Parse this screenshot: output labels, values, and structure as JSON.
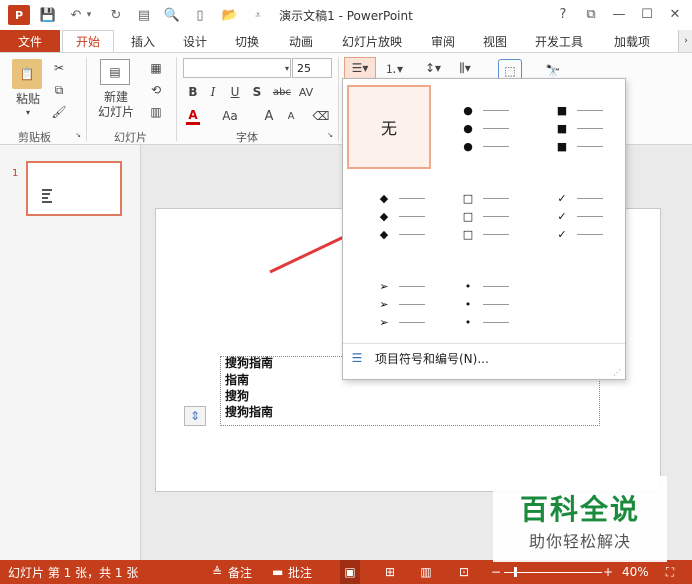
{
  "app": {
    "title": "演示文稿1 - PowerPoint",
    "icon_label": "P"
  },
  "window_controls": {
    "help": "?",
    "restore_ribbon": "⧉",
    "minimize": "—",
    "maximize": "☐",
    "close": "✕"
  },
  "tabs": [
    {
      "label": "文件"
    },
    {
      "label": "开始"
    },
    {
      "label": "插入"
    },
    {
      "label": "设计"
    },
    {
      "label": "切换"
    },
    {
      "label": "动画"
    },
    {
      "label": "幻灯片放映"
    },
    {
      "label": "审阅"
    },
    {
      "label": "视图"
    },
    {
      "label": "开发工具"
    },
    {
      "label": "加载项"
    }
  ],
  "ribbon": {
    "clipboard": {
      "paste": "粘贴",
      "group": "剪贴板"
    },
    "slides": {
      "new_slide": "新建",
      "new_slide2": "幻灯片",
      "group": "幻灯片"
    },
    "font": {
      "font_name": "",
      "font_size": "25",
      "bold": "B",
      "italic": "I",
      "underline": "U",
      "shadow": "S",
      "strike": "abc",
      "spacing": "AV",
      "color": "A",
      "case": "Aa",
      "grow": "A",
      "shrink": "A",
      "group": "字体"
    }
  },
  "gallery": {
    "none_label": "无",
    "cells": [
      {
        "symbol": "●"
      },
      {
        "symbol": "■"
      },
      {
        "symbol": "◆"
      },
      {
        "symbol": "□"
      },
      {
        "symbol": "✓"
      },
      {
        "symbol": "➢"
      },
      {
        "symbol": "•"
      }
    ],
    "footer": "项目符号和编号(N)..."
  },
  "slide": {
    "number": "1",
    "lines": [
      "搜狗指南",
      "指南",
      "搜狗",
      "搜狗指南"
    ]
  },
  "status": {
    "slide_info": "幻灯片 第 1 张，共 1 张",
    "notes": "备注",
    "comments": "批注",
    "zoom": "40%"
  },
  "watermark": {
    "big": "百科全说",
    "small": "助你轻松解决"
  },
  "colors": {
    "accent": "#c43e1c",
    "arrow": "#e03a3a",
    "watermark_green": "#1a8a3c"
  }
}
